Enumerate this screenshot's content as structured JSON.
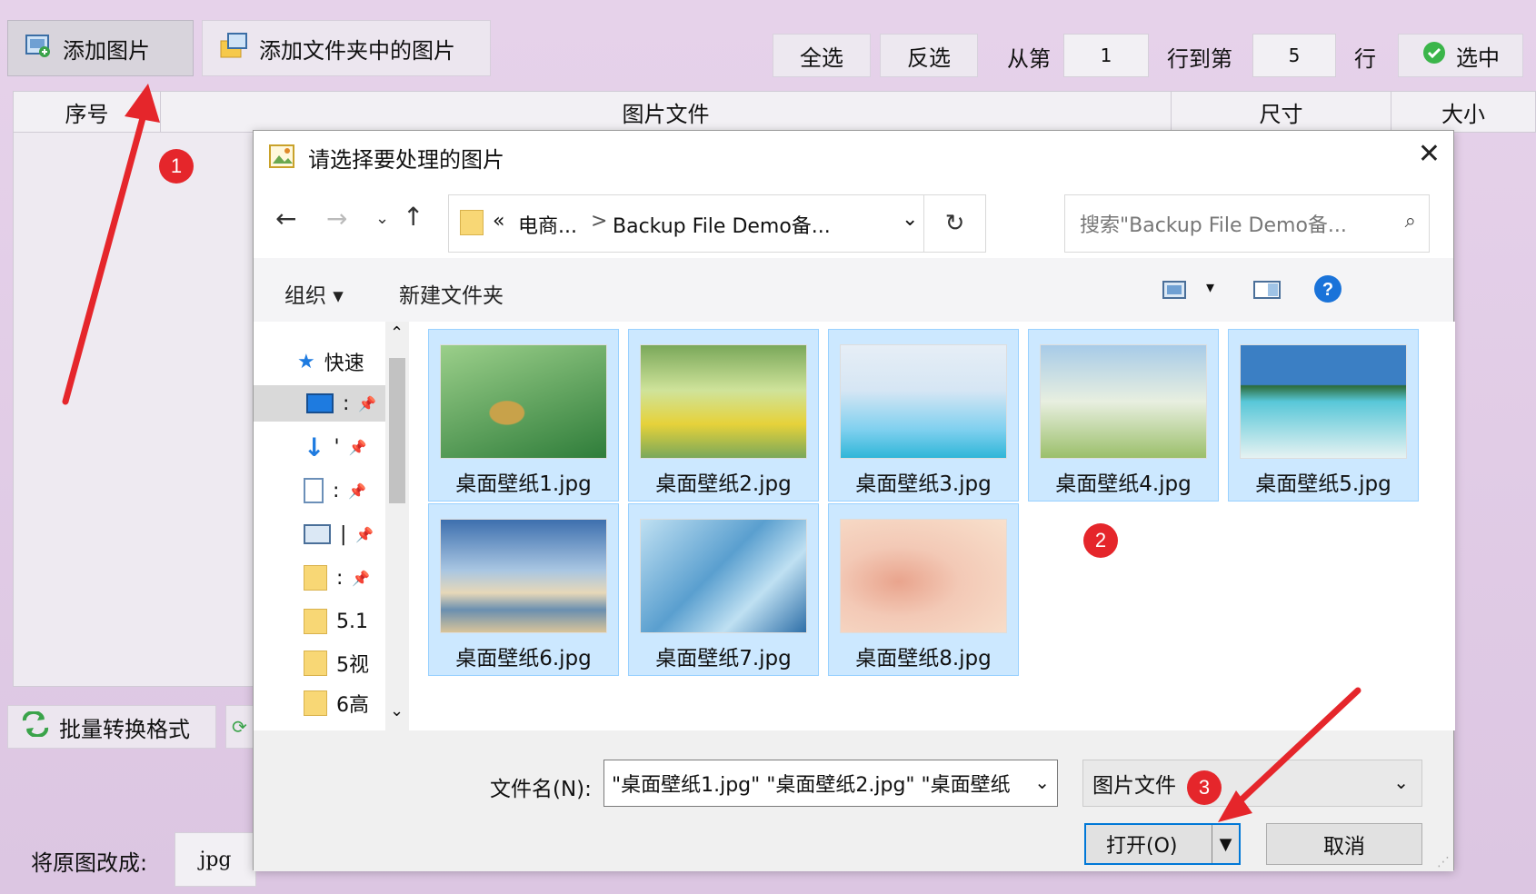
{
  "toolbar": {
    "add_image": "添加图片",
    "add_folder_images": "添加文件夹中的图片",
    "select_all": "全选",
    "invert": "反选",
    "from_row": "从第",
    "from_value": "1",
    "to_row": "行到第",
    "to_value": "5",
    "row": "行",
    "select": "选中"
  },
  "grid": {
    "columns": [
      "序号",
      "图片文件",
      "尺寸",
      "大小"
    ]
  },
  "bottom": {
    "batch_convert": "批量转换格式",
    "convert_to_label": "将原图改成:",
    "format_value": "jpg"
  },
  "markers": [
    "1",
    "2",
    "3"
  ],
  "dialog": {
    "title": "请选择要处理的图片",
    "breadcrumb": {
      "prefix": "«",
      "crumb1": "电商...",
      "separator": ">",
      "crumb2": "Backup File Demo备..."
    },
    "search_placeholder": "搜索\"Backup File Demo备...",
    "organize": "组织 ▾",
    "new_folder": "新建文件夹",
    "nav": {
      "quick_access": "快速",
      "items": [
        ":",
        "'",
        ":",
        "|",
        ":",
        "5.1",
        "5视",
        "6高"
      ]
    },
    "files": [
      {
        "name": "桌面壁纸1.jpg",
        "colors": [
          "#2f7d3a",
          "#9bcf8a",
          "#c8a24a"
        ]
      },
      {
        "name": "桌面壁纸2.jpg",
        "colors": [
          "#7aa85a",
          "#e6d23a",
          "#cfe39a"
        ]
      },
      {
        "name": "桌面壁纸3.jpg",
        "colors": [
          "#d6e6f4",
          "#7fd0ef",
          "#2fb6d8"
        ]
      },
      {
        "name": "桌面壁纸4.jpg",
        "colors": [
          "#a7cbe8",
          "#e8efe0",
          "#9bbf6a"
        ]
      },
      {
        "name": "桌面壁纸5.jpg",
        "colors": [
          "#3b7fc4",
          "#58c7d8",
          "#e6f2f2"
        ]
      },
      {
        "name": "桌面壁纸6.jpg",
        "colors": [
          "#3d6fae",
          "#e7d8b8",
          "#6a8fb0"
        ]
      },
      {
        "name": "桌面壁纸7.jpg",
        "colors": [
          "#5a9fcf",
          "#bfe0f2",
          "#2e6fa8"
        ]
      },
      {
        "name": "桌面壁纸8.jpg",
        "colors": [
          "#f3c9b6",
          "#f8e0cc",
          "#e9a48d"
        ]
      }
    ],
    "filename_label": "文件名(N):",
    "filename_value": "\"桌面壁纸1.jpg\" \"桌面壁纸2.jpg\" \"桌面壁纸",
    "filetype": "图片文件",
    "open": "打开(O)",
    "cancel": "取消"
  },
  "colors": {
    "accent": "#0078d7",
    "marker": "#e5262b",
    "selection": "#cce8ff"
  }
}
